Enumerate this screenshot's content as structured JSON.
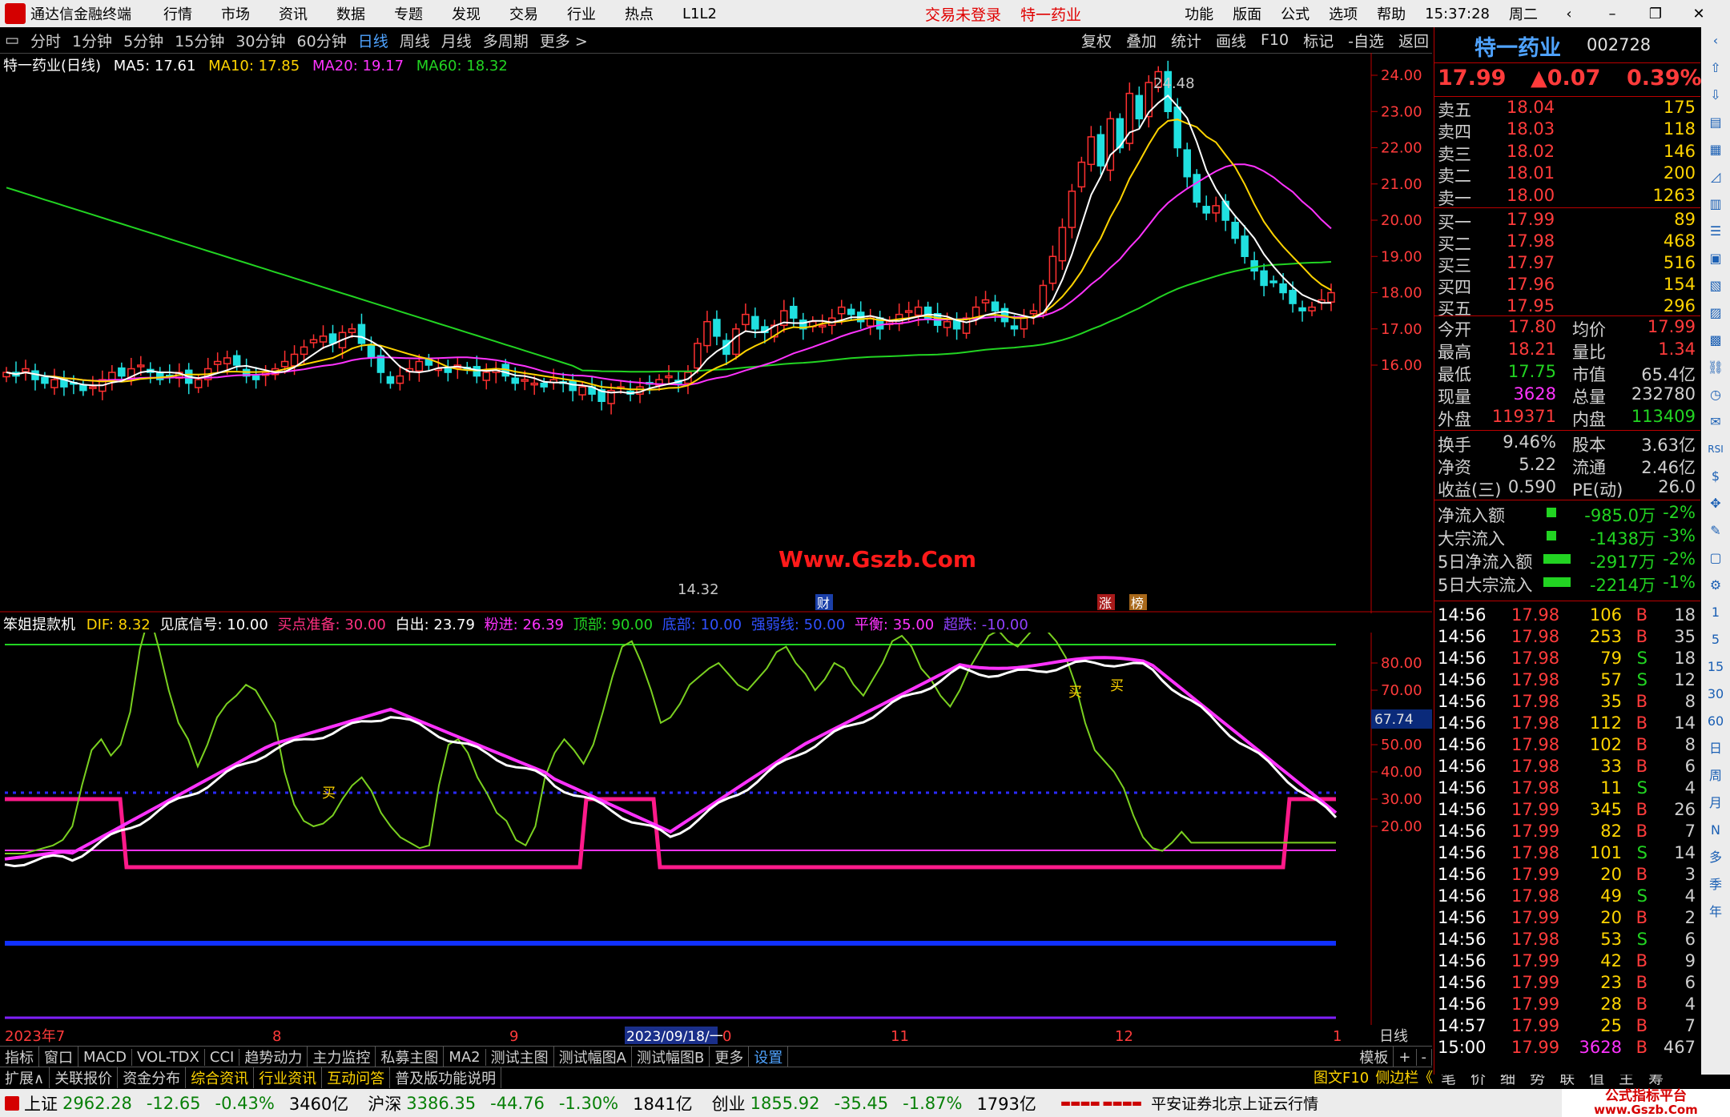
{
  "menubar": {
    "app_title": "通达信金融终端",
    "items": [
      "行情",
      "市场",
      "资讯",
      "数据",
      "专题",
      "发现",
      "交易",
      "行业",
      "热点",
      "L1L2"
    ],
    "trade_status": "交易未登录",
    "stock_name": "特一药业",
    "right_items": [
      "功能",
      "版面",
      "公式",
      "选项",
      "帮助"
    ],
    "time": "15:37:28",
    "weekday": "周二"
  },
  "periodbar": {
    "items": [
      "分时",
      "1分钟",
      "5分钟",
      "15分钟",
      "30分钟",
      "60分钟",
      "日线",
      "周线",
      "月线",
      "多周期",
      "更多 >"
    ],
    "active": "日线",
    "right_items": [
      "复权",
      "叠加",
      "统计",
      "画线",
      "F10",
      "标记",
      "-自选",
      "返回"
    ]
  },
  "main_header": {
    "title": "特一药业(日线)",
    "ma5": "MA5: 17.61",
    "ma10": "MA10: 17.85",
    "ma20": "MA20: 19.17",
    "ma60": "MA60: 18.32",
    "colors": {
      "ma5": "#ffffff",
      "ma10": "#ffd400",
      "ma20": "#ff33ff",
      "ma60": "#22d422"
    }
  },
  "price_axis": [
    "24.00",
    "23.00",
    "22.00",
    "21.00",
    "20.00",
    "19.00",
    "18.00",
    "17.00",
    "16.00"
  ],
  "annotations": {
    "high": "24.48",
    "low": "14.32",
    "watermark": "Www.Gszb.Com",
    "badge_cai": "财",
    "badge_zhang": "涨",
    "badge_bang": "榜"
  },
  "indicator_header": {
    "name": "笨姐提款机",
    "dif": "DIF: 8.32",
    "bottom_signal": "见底信号: 10.00",
    "buy_ready": "买点准备: 30.00",
    "white_out": "白出: 23.79",
    "pink_in": "粉进: 26.39",
    "top": "顶部: 90.00",
    "bottom": "底部: 10.00",
    "strong_weak": "强弱线: 50.00",
    "balance": "平衡: 35.00",
    "oversold": "超跌: -10.00"
  },
  "indicator_axis": [
    "80.00",
    "70.00",
    "60.00",
    "50.00",
    "40.00",
    "30.00",
    "20.00"
  ],
  "indicator_current": "67.74",
  "buy_label": "买",
  "date_axis": [
    "2023年7",
    "8",
    "9",
    "2023/09/18/一",
    "0",
    "11",
    "12",
    "1"
  ],
  "date_axis_right": "日线",
  "tabs1": [
    "指标",
    "窗口",
    "MACD",
    "VOL-TDX",
    "CCI",
    "趋势动力",
    "主力监控",
    "私募主图",
    "MA2",
    "测试主图",
    "测试幅图A",
    "测试幅图B",
    "更多",
    "设置"
  ],
  "tabs1_right": [
    "模板",
    "+",
    "-"
  ],
  "tabs2": [
    "扩展∧",
    "关联报价",
    "资金分布",
    "综合资讯",
    "行业资讯",
    "互动问答",
    "普及版功能说明"
  ],
  "tabs2_right": [
    "图文F10",
    "侧边栏《",
    "笔",
    "价",
    "细",
    "势",
    "联",
    "值",
    "主",
    "筹"
  ],
  "quote": {
    "name": "特一药业",
    "code": "002728",
    "price": "17.99",
    "change": "▲0.07",
    "pct": "0.39%",
    "asks": [
      {
        "label": "卖五",
        "price": "18.04",
        "vol": "175"
      },
      {
        "label": "卖四",
        "price": "18.03",
        "vol": "118"
      },
      {
        "label": "卖三",
        "price": "18.02",
        "vol": "146"
      },
      {
        "label": "卖二",
        "price": "18.01",
        "vol": "200"
      },
      {
        "label": "卖一",
        "price": "18.00",
        "vol": "1263"
      }
    ],
    "bids": [
      {
        "label": "买一",
        "price": "17.99",
        "vol": "89"
      },
      {
        "label": "买二",
        "price": "17.98",
        "vol": "468"
      },
      {
        "label": "买三",
        "price": "17.97",
        "vol": "516"
      },
      {
        "label": "买四",
        "price": "17.96",
        "vol": "154"
      },
      {
        "label": "买五",
        "price": "17.95",
        "vol": "296"
      }
    ],
    "stats": [
      [
        "今开",
        "17.80",
        "均价",
        "17.99"
      ],
      [
        "最高",
        "18.21",
        "量比",
        "1.34"
      ],
      [
        "最低",
        "17.75",
        "市值",
        "65.4亿"
      ],
      [
        "现量",
        "3628",
        "总量",
        "232780"
      ],
      [
        "外盘",
        "119371",
        "内盘",
        "113409"
      ]
    ],
    "stats2": [
      [
        "换手",
        "9.46%",
        "股本",
        "3.63亿"
      ],
      [
        "净资",
        "5.22",
        "流通",
        "2.46亿"
      ],
      [
        "收益(三)",
        "0.590",
        "PE(动)",
        "26.0"
      ]
    ],
    "flows": [
      [
        "净流入额",
        "-985.0万",
        "-2%"
      ],
      [
        "大宗流入",
        "-1438万",
        "-3%"
      ],
      [
        "5日净流入额",
        "-2917万",
        "-2%"
      ],
      [
        "5日大宗流入",
        "-2214万",
        "-1%"
      ]
    ],
    "ticks": [
      [
        "14:56",
        "17.98",
        "106",
        "B",
        "18"
      ],
      [
        "14:56",
        "17.98",
        "253",
        "B",
        "35"
      ],
      [
        "14:56",
        "17.98",
        "79",
        "S",
        "18"
      ],
      [
        "14:56",
        "17.98",
        "57",
        "S",
        "12"
      ],
      [
        "14:56",
        "17.98",
        "35",
        "B",
        "8"
      ],
      [
        "14:56",
        "17.98",
        "112",
        "B",
        "14"
      ],
      [
        "14:56",
        "17.98",
        "102",
        "B",
        "8"
      ],
      [
        "14:56",
        "17.98",
        "33",
        "B",
        "6"
      ],
      [
        "14:56",
        "17.98",
        "11",
        "S",
        "4"
      ],
      [
        "14:56",
        "17.99",
        "345",
        "B",
        "26"
      ],
      [
        "14:56",
        "17.99",
        "82",
        "B",
        "7"
      ],
      [
        "14:56",
        "17.98",
        "101",
        "S",
        "14"
      ],
      [
        "14:56",
        "17.99",
        "20",
        "B",
        "3"
      ],
      [
        "14:56",
        "17.98",
        "49",
        "S",
        "4"
      ],
      [
        "14:56",
        "17.99",
        "20",
        "B",
        "2"
      ],
      [
        "14:56",
        "17.98",
        "53",
        "S",
        "6"
      ],
      [
        "14:56",
        "17.99",
        "42",
        "B",
        "9"
      ],
      [
        "14:56",
        "17.99",
        "23",
        "B",
        "6"
      ],
      [
        "14:56",
        "17.99",
        "28",
        "B",
        "4"
      ],
      [
        "14:57",
        "17.99",
        "25",
        "B",
        "7"
      ],
      [
        "15:00",
        "17.99",
        "3628",
        "B",
        "467"
      ]
    ]
  },
  "sidebar_items": [
    "日",
    "周",
    "月",
    "N",
    "多",
    "季",
    "年"
  ],
  "sidebar_nums": [
    "1",
    "5",
    "15",
    "30",
    "60"
  ],
  "statusbar": {
    "sh_name": "上证",
    "sh_val": "2962.28",
    "sh_chg": "-12.65",
    "sh_pct": "-0.43%",
    "sh_amt": "3460亿",
    "sz_name": "沪深",
    "sz_val": "3386.35",
    "sz_chg": "-44.76",
    "sz_pct": "-1.30%",
    "sz_amt": "1841亿",
    "cy_name": "创业",
    "cy_val": "1855.92",
    "cy_chg": "-35.45",
    "cy_pct": "-1.87%",
    "cy_amt": "1793亿",
    "broker": "平安证券北京上证云行情",
    "brand": "公式指标平台",
    "brand_url": "www.Gszb.Com"
  }
}
